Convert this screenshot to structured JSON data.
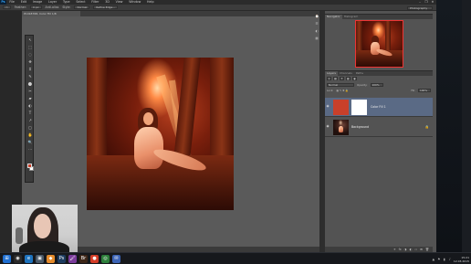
{
  "app": {
    "logo": "Ps",
    "menu": [
      "File",
      "Edit",
      "Image",
      "Layer",
      "Type",
      "Select",
      "Filter",
      "3D",
      "View",
      "Window",
      "Help"
    ],
    "window_controls": [
      "–",
      "❐",
      "✕"
    ]
  },
  "options_bar": {
    "tool_glyph": "▭",
    "feather_label": "Feather:",
    "feather_value": "0 px",
    "antialias_label": "Anti-alias",
    "style_label": "Style:",
    "style_value": "Normal",
    "refine_label": "Refine Edge...",
    "workspace": "Photography"
  },
  "document": {
    "tab_title": "P1018768, Color Fill 1/8",
    "status": "Doc: 12.4M/12.4M"
  },
  "toolbar": {
    "tools": [
      "↖",
      "⬚",
      "◌",
      "✥",
      "⌗",
      "✎",
      "⬤",
      "✂",
      "▰",
      "◐",
      "T",
      "↗",
      "▢",
      "✋",
      "🔍",
      "⋯"
    ],
    "foreground_color": "#c9402a",
    "background_color": "#ffffff"
  },
  "navigator": {
    "tabs": [
      "Navigator",
      "Histogram"
    ]
  },
  "layers": {
    "tabs": [
      "Layers",
      "Channels",
      "Paths"
    ],
    "tool_icons": [
      "⚲",
      "▦",
      "T",
      "◧",
      "◉"
    ],
    "blend_mode": "Normal",
    "opacity_label": "Opacity:",
    "opacity_value": "100%",
    "lock_label": "Lock:",
    "fill_label": "Fill:",
    "fill_value": "100%",
    "items": [
      {
        "name": "Color Fill 1",
        "swatch": "#c9402a",
        "selected": true
      },
      {
        "name": "Background",
        "locked": true,
        "selected": false
      }
    ],
    "footer_icons": [
      "⚭",
      "fx",
      "◑",
      "◐",
      "▭",
      "⊞",
      "🗑"
    ]
  },
  "taskbar": {
    "icons": [
      "⊞",
      "◉",
      "e",
      "▣",
      "◆",
      "Ps",
      "🖌",
      "Br",
      "●",
      "◎",
      "✉"
    ],
    "icon_colors": [
      "#1f6fd1",
      "#2a2a2a",
      "#1e73be",
      "#4a5968",
      "#e48a2a",
      "#1c3b5e",
      "#7a3b9a",
      "#3d2618",
      "#d33c27",
      "#2d7f3b",
      "#3b63b5"
    ],
    "tray_icons": [
      "▲",
      "⚑",
      "▮",
      "♪"
    ],
    "time": "15:21",
    "date": "12.03.2015"
  }
}
